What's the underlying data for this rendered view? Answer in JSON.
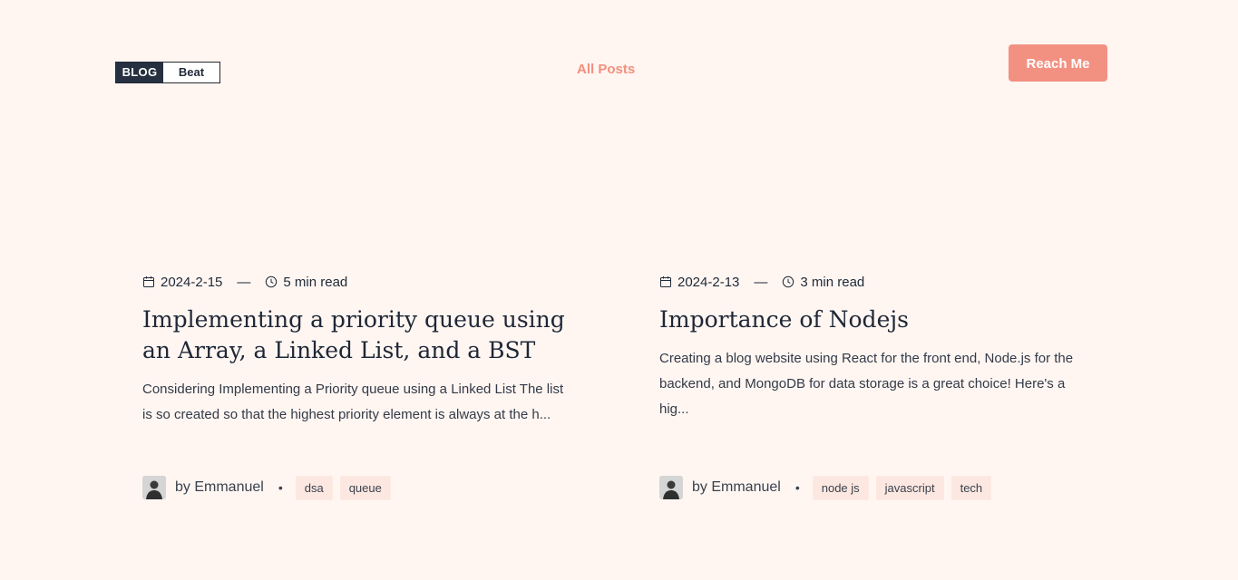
{
  "header": {
    "logo_left": "BLOG",
    "logo_right": "Beat",
    "nav_link": "All Posts",
    "cta_label": "Reach Me"
  },
  "posts": [
    {
      "date": "2024-2-15",
      "separator": "—",
      "read_time": "5 min read",
      "title": "Implementing a priority queue using an Array, a Linked List, and a BST",
      "excerpt": "Considering Implementing a Priority queue using a Linked List The list is so created so that the highest priority element is always at the h...",
      "author": "by Emmanuel",
      "bullet": "•",
      "tags": [
        "dsa",
        "queue"
      ]
    },
    {
      "date": "2024-2-13",
      "separator": "—",
      "read_time": "3 min read",
      "title": "Importance of Nodejs",
      "excerpt": "Creating a blog website using React for the front end, Node.js for the backend, and MongoDB for data storage is a great choice! Here's a hig...",
      "author": "by Emmanuel",
      "bullet": "•",
      "tags": [
        "node js",
        "javascript",
        "tech"
      ]
    }
  ],
  "colors": {
    "background": "#fff6f2",
    "accent": "#f29182",
    "logo_dark": "#263040",
    "tag_bg": "#fde8e1"
  },
  "icons": {
    "date": "calendar-icon",
    "time": "clock-icon",
    "avatar": "user-avatar"
  }
}
